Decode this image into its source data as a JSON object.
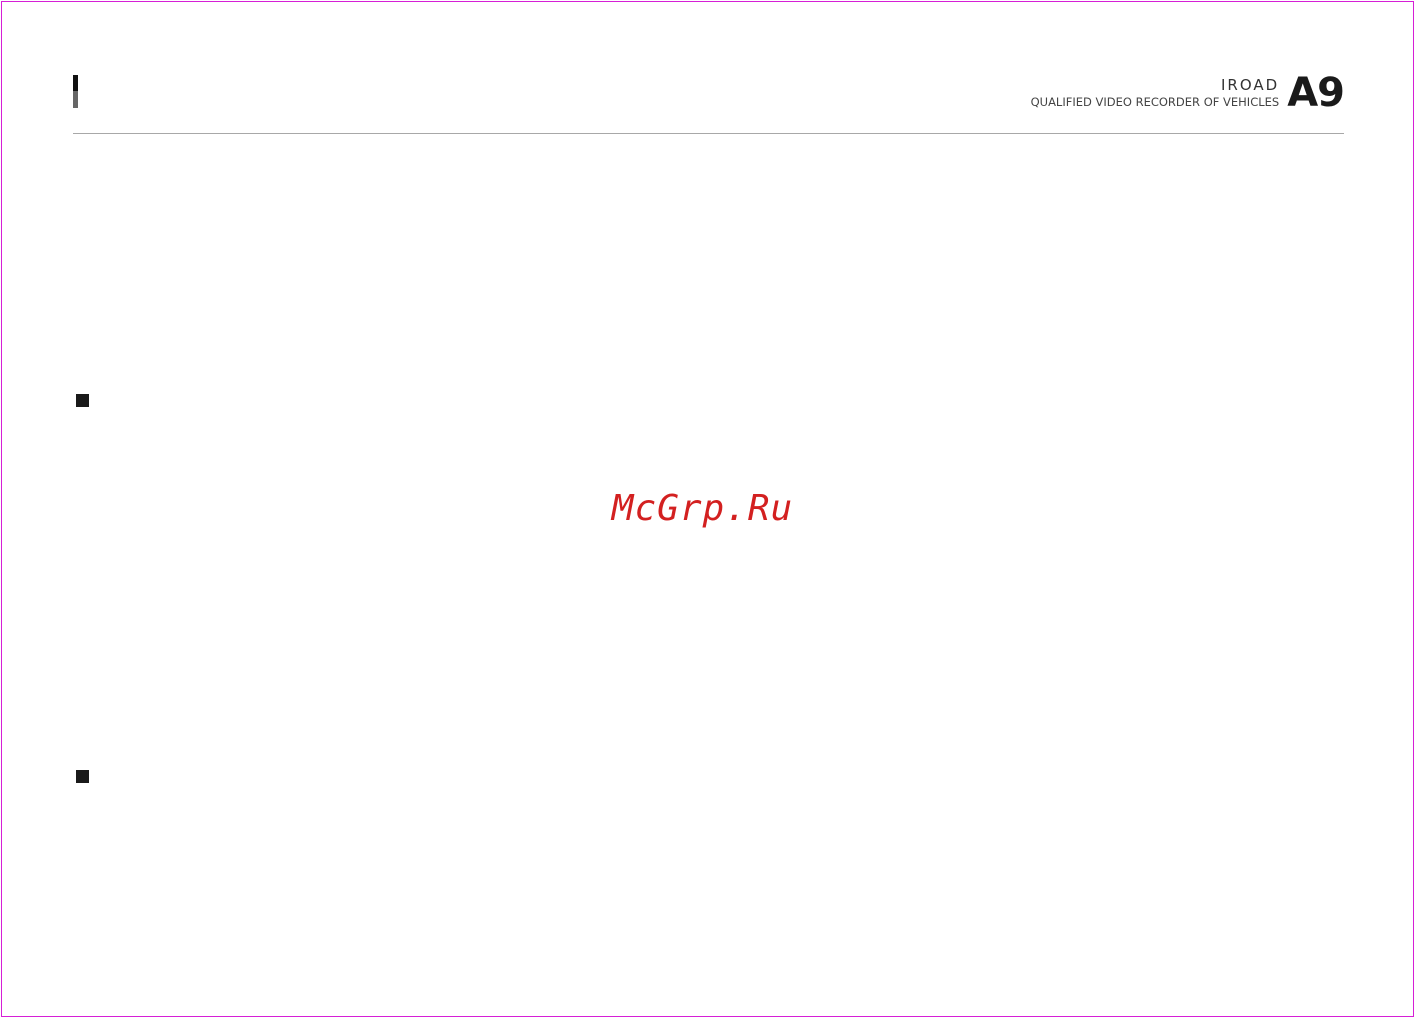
{
  "header": {
    "brand_name": "IROAD",
    "brand_tagline": "QUALIFIED VIDEO RECORDER OF VEHICLES",
    "model": "A9"
  },
  "watermark": {
    "text": "McGrp.Ru",
    "color": "#d32020"
  },
  "colors": {
    "frame": "#d61fd6",
    "rule": "#a8a8a8",
    "bullet": "#1a1a1a"
  }
}
